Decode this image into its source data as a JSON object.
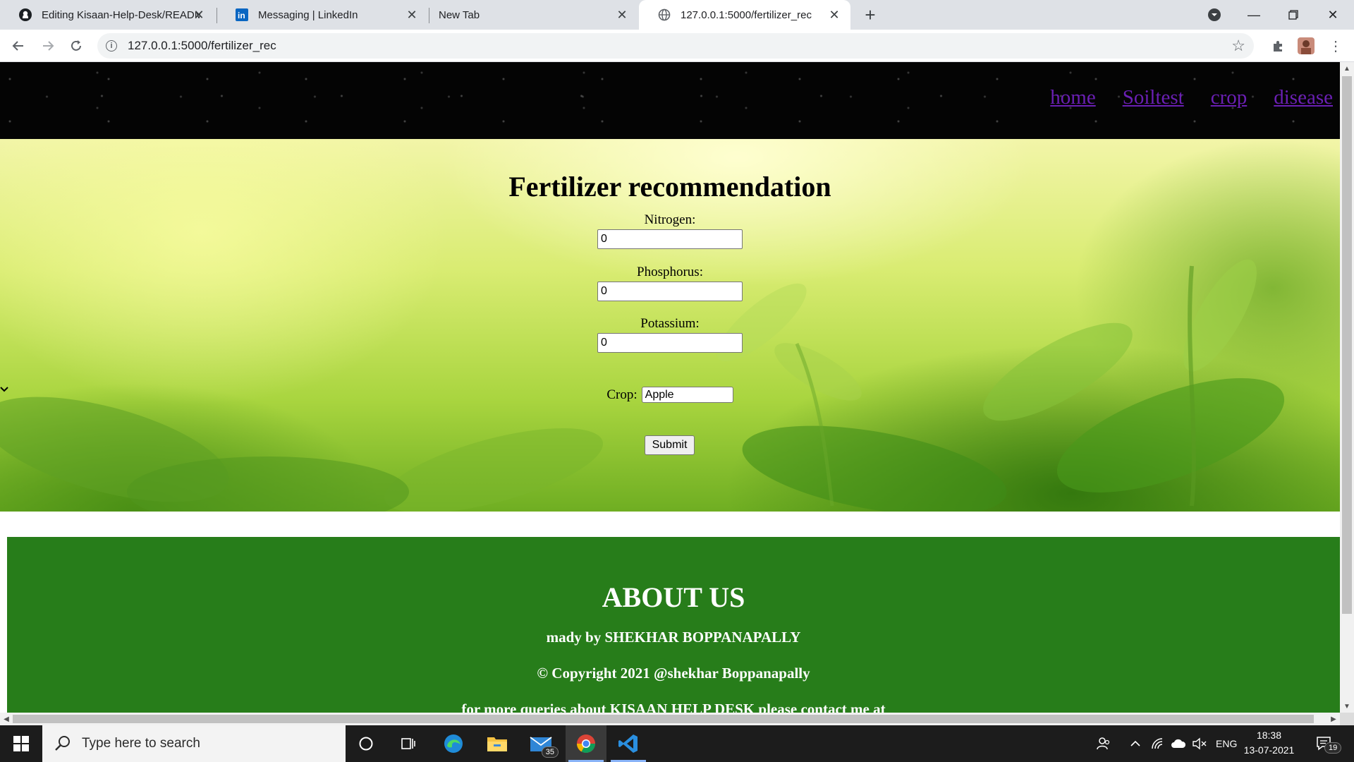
{
  "browser": {
    "tabs": [
      {
        "title": "Editing Kisaan-Help-Desk/READM",
        "icon": "github-icon"
      },
      {
        "title": "Messaging | LinkedIn",
        "icon": "linkedin-icon"
      },
      {
        "title": "New Tab",
        "icon": ""
      },
      {
        "title": "127.0.0.1:5000/fertilizer_rec",
        "icon": "globe-icon",
        "active": true
      }
    ],
    "url": "127.0.0.1:5000/fertilizer_rec"
  },
  "site": {
    "nav": [
      "home",
      "Soiltest",
      "crop",
      "disease"
    ],
    "form": {
      "title": "Fertilizer recommendation",
      "nitrogen_label": "Nitrogen:",
      "nitrogen_value": "0",
      "phosphorus_label": "Phosphorus:",
      "phosphorus_value": "0",
      "potassium_label": "Potassium:",
      "potassium_value": "0",
      "crop_label": "Crop:",
      "crop_selected": "Apple",
      "submit_label": "Submit"
    },
    "about": {
      "heading": "ABOUT US",
      "made_by": "mady by SHEKHAR BOPPANAPALLY",
      "copyright": "© Copyright 2021 @shekhar Boppanapally",
      "contact": "for more queries about KISAAN HELP DESK please contact me at"
    }
  },
  "taskbar": {
    "search_placeholder": "Type here to search",
    "mail_badge": "35",
    "language": "ENG",
    "time": "18:38",
    "date": "13-07-2021",
    "notification_count": "19"
  },
  "colors": {
    "nav_link": "#6a1fb3",
    "about_bg": "#277d1a",
    "header_bg": "#040404"
  }
}
